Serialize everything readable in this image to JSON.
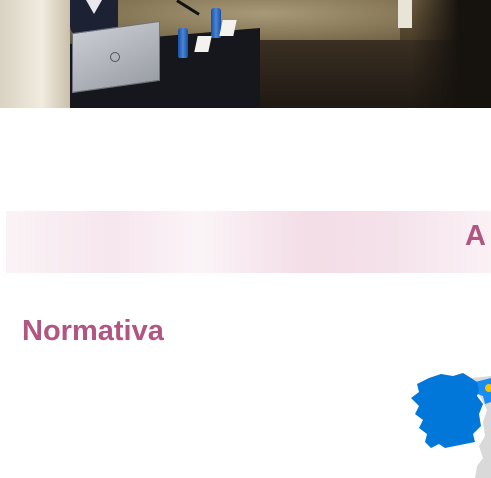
{
  "hero": {
    "description_icon": "photo"
  },
  "banner": {
    "text": "A",
    "gradient_colors": [
      "#faf3f6",
      "#f3dde6",
      "#faf1f5"
    ]
  },
  "section": {
    "title": "Normativa"
  },
  "map": {
    "region_color": "#0077d9",
    "neighbor_color": "#1a8bf0",
    "land_color": "#d9d9d9",
    "marker_color": "#f5c400"
  },
  "colors": {
    "accent": "#b15683",
    "background": "#ffffff"
  }
}
